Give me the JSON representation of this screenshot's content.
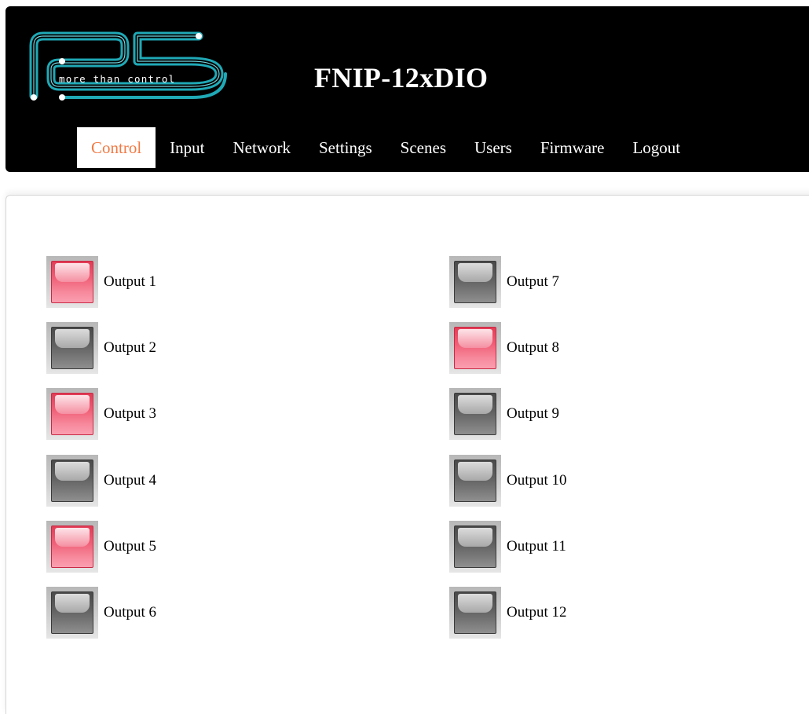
{
  "app": {
    "title": "FNIP-12xDIO",
    "logo_tagline": "more than control",
    "logo_icon": "p5-logo"
  },
  "nav": {
    "items": [
      {
        "label": "Control",
        "active": true
      },
      {
        "label": "Input",
        "active": false
      },
      {
        "label": "Network",
        "active": false
      },
      {
        "label": "Settings",
        "active": false
      },
      {
        "label": "Scenes",
        "active": false
      },
      {
        "label": "Users",
        "active": false
      },
      {
        "label": "Firmware",
        "active": false
      },
      {
        "label": "Logout",
        "active": false
      }
    ]
  },
  "outputs": [
    {
      "label": "Output 1",
      "state": "on"
    },
    {
      "label": "Output 2",
      "state": "off"
    },
    {
      "label": "Output 3",
      "state": "on"
    },
    {
      "label": "Output 4",
      "state": "off"
    },
    {
      "label": "Output 5",
      "state": "on"
    },
    {
      "label": "Output 6",
      "state": "off"
    },
    {
      "label": "Output 7",
      "state": "off"
    },
    {
      "label": "Output 8",
      "state": "on"
    },
    {
      "label": "Output 9",
      "state": "off"
    },
    {
      "label": "Output 10",
      "state": "off"
    },
    {
      "label": "Output 11",
      "state": "off"
    },
    {
      "label": "Output 12",
      "state": "off"
    }
  ],
  "colors": {
    "header_bg": "#000000",
    "active_tab_text": "#f07a44",
    "logo_teal": "#1fa9b6",
    "output_on": "#ef5f76",
    "output_off": "#5e5e5e"
  }
}
